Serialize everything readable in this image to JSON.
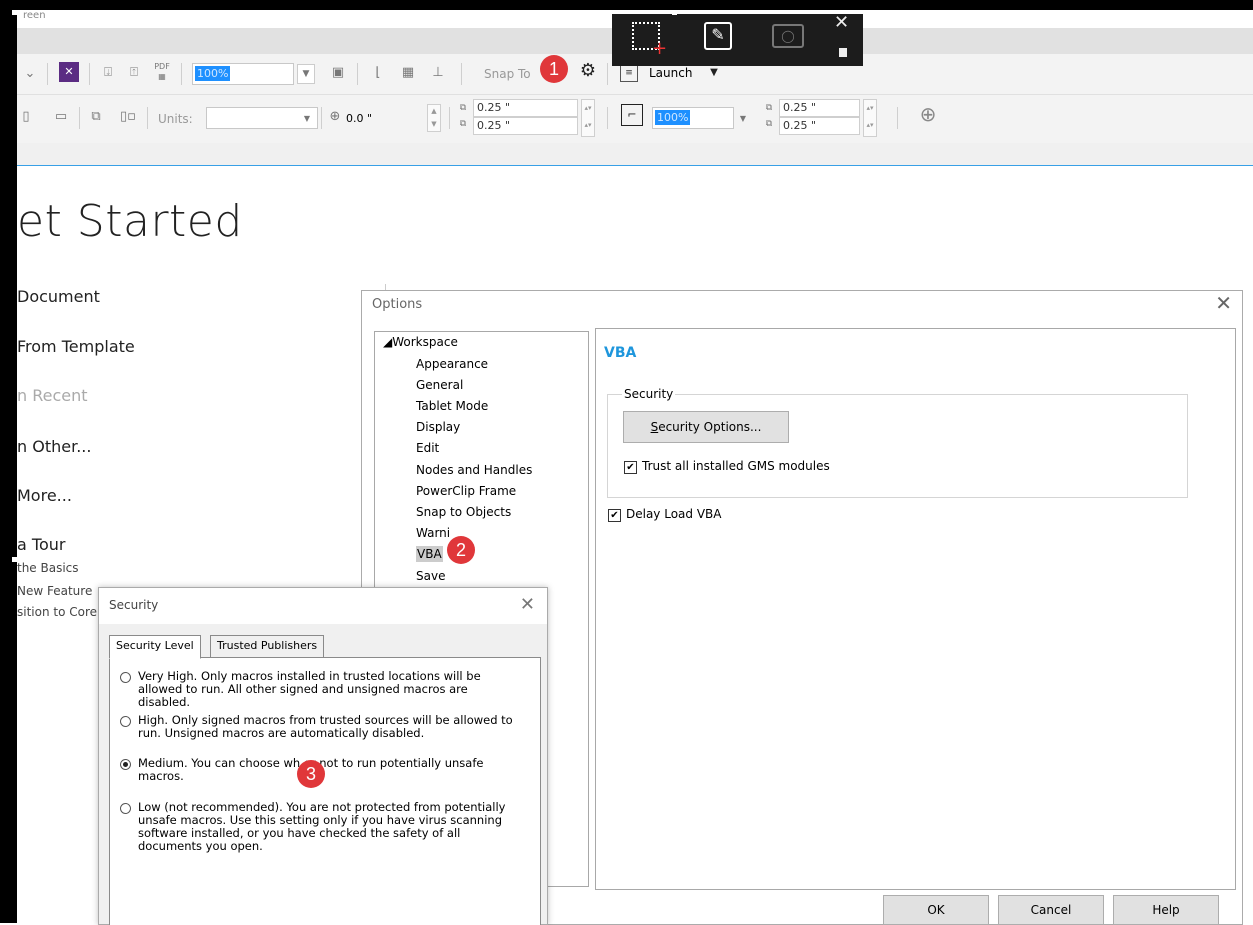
{
  "toolbar": {
    "zoom_value": "100%",
    "snap_to_label": "Snap To",
    "launch_label": "Launch",
    "units_label": "Units:",
    "position_value": "0.0 \"",
    "dup_x": "0.25 \"",
    "dup_y": "0.25 \"",
    "nudge_x": "0.25 \"",
    "nudge_y": "0.25 \"",
    "scale_value": "100%"
  },
  "capture_bar": {
    "icons": [
      "region-capture-icon",
      "edit-icon",
      "camera-icon",
      "close-icon"
    ]
  },
  "get_started": {
    "title": "et Started",
    "items": [
      "Document",
      "From Template",
      "n Recent",
      "n Other...",
      "More...",
      "a Tour"
    ],
    "sub_items": [
      "the Basics",
      "New Feature",
      "sition to Core"
    ]
  },
  "options_dialog": {
    "title": "Options",
    "tree_root": "Workspace",
    "tree_items": [
      "Appearance",
      "General",
      "Tablet Mode",
      "Display",
      "Edit",
      "Nodes and Handles",
      "PowerClip Frame",
      "Snap to Objects",
      "Warni",
      "VBA",
      "Save"
    ],
    "panel_title": "VBA",
    "group_label": "Security",
    "security_options_button": "Security Options...",
    "trust_gms_label": "Trust all installed GMS modules",
    "delay_load_label": "Delay Load VBA",
    "ok": "OK",
    "cancel": "Cancel",
    "help": "Help"
  },
  "security_dialog": {
    "title": "Security",
    "tabs": [
      "Security Level",
      "Trusted Publishers"
    ],
    "options": [
      "Very High. Only macros installed in trusted locations will be allowed to run. All other signed and unsigned macros are disabled.",
      "High. Only signed macros from trusted sources will be allowed to run. Unsigned macros are automatically disabled.",
      "Medium. You can choose wh       or not to run potentially unsafe macros.",
      "Low (not recommended). You are not protected from potentially unsafe macros. Use this setting only if you have virus scanning software installed, or you have checked the safety of all documents you open."
    ],
    "selected_index": 2
  },
  "badges": [
    "1",
    "2",
    "3"
  ],
  "colors": {
    "accent_blue": "#1e96dc",
    "badge_red": "#e0373a",
    "zoom_highlight": "#1e90ff"
  }
}
